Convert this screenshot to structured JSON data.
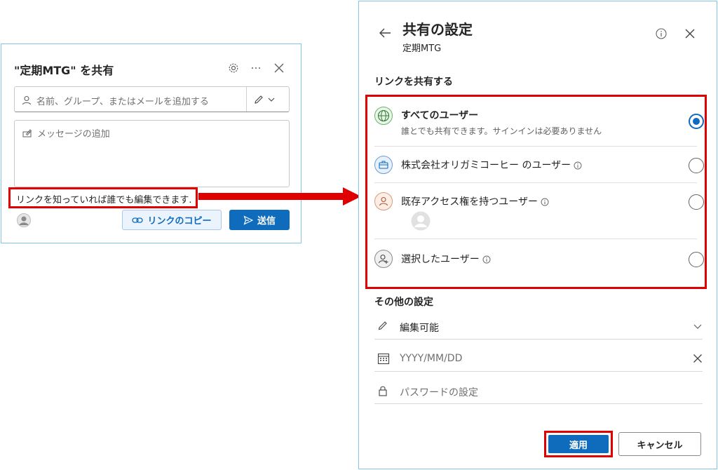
{
  "share_dialog": {
    "title": "\"定期MTG\" を共有",
    "recipients_placeholder": "名前、グループ、またはメールを追加する",
    "message_placeholder": "メッセージの追加",
    "link_status": "リンクを知っていれば誰でも編集できます.",
    "copy_link_label": "リンクのコピー",
    "send_label": "送信",
    "icons": [
      "gear-icon",
      "more-icon",
      "close-icon",
      "person-icon",
      "pencil-icon",
      "chevron-down-icon",
      "edit-note-icon",
      "link-icon",
      "send-icon",
      "avatar"
    ]
  },
  "settings_panel": {
    "title": "共有の設定",
    "subtitle": "定期MTG",
    "share_link_heading": "リンクを共有する",
    "options": [
      {
        "label": "すべてのユーザー",
        "description": "誰とでも共有できます。サインインは必要ありません",
        "selected": true,
        "icon": "globe-icon"
      },
      {
        "label": "株式会社オリガミコーヒー のユーザー",
        "selected": false,
        "icon": "briefcase-icon"
      },
      {
        "label": "既存アクセス権を持つユーザー",
        "selected": false,
        "icon": "person-icon"
      },
      {
        "label": "選択したユーザー",
        "selected": false,
        "icon": "person-add-icon"
      }
    ],
    "other_settings_heading": "その他の設定",
    "permission_value": "編集可能",
    "date_placeholder": "YYYY/MM/DD",
    "password_placeholder": "パスワードの設定",
    "apply_label": "適用",
    "cancel_label": "キャンセル"
  },
  "colors": {
    "accent": "#0f6cbd",
    "highlight_border": "#e00000",
    "panel_border": "#7fc6ea"
  }
}
